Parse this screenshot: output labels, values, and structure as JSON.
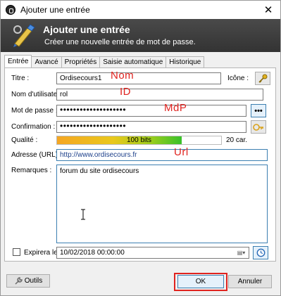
{
  "window": {
    "title": "Ajouter une entrée"
  },
  "banner": {
    "title": "Ajouter une entrée",
    "subtitle": "Créer une nouvelle entrée de mot de passe."
  },
  "tabs": [
    {
      "label": "Entrée",
      "active": true
    },
    {
      "label": "Avancé"
    },
    {
      "label": "Propriétés"
    },
    {
      "label": "Saisie automatique"
    },
    {
      "label": "Historique"
    }
  ],
  "form": {
    "title_label": "Titre :",
    "title_value": "Ordisecours1",
    "icon_label": "Icône :",
    "username_label": "Nom d'utilisateur :",
    "username_value": "rol",
    "password_label": "Mot de passe :",
    "password_value": "••••••••••••••••••••",
    "confirm_label": "Confirmation :",
    "confirm_value": "••••••••••••••••••••",
    "quality_label": "Qualité :",
    "quality_text": "100 bits",
    "quality_level": 0.76,
    "char_count": "20 car.",
    "url_label": "Adresse (URL) :",
    "url_value": "http://www.ordisecours.fr",
    "notes_label": "Remarques :",
    "notes_value": "forum du site ordisecours",
    "expires_label": "Expirera le :",
    "expires_value": "10/02/2018 00:00:00"
  },
  "annotations": {
    "nom": "Nom",
    "id": "ID",
    "mdp": "MdP",
    "url": "Url"
  },
  "buttons": {
    "tools": "Outils",
    "ok": "OK",
    "cancel": "Annuler",
    "reveal": "•••"
  },
  "colors": {
    "annotation_red": "#e0231f",
    "banner": "#3a3a3a",
    "focus_blue": "#3c7fb1"
  }
}
